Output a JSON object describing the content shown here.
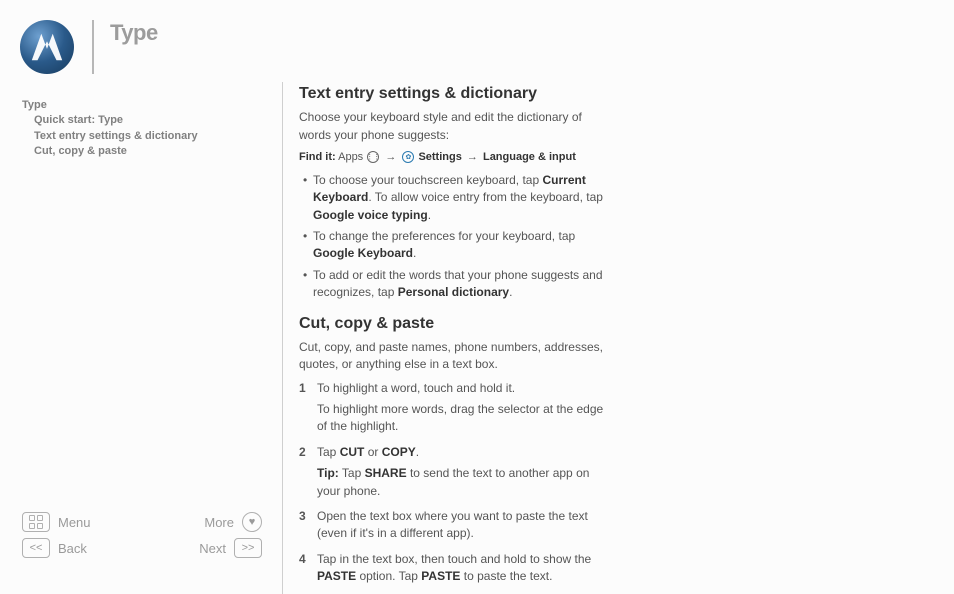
{
  "header": {
    "title": "Type"
  },
  "toc": {
    "root": "Type",
    "items": [
      "Quick start: Type",
      "Text entry settings & dictionary",
      "Cut, copy & paste"
    ]
  },
  "nav": {
    "menu": "Menu",
    "more": "More",
    "back": "Back",
    "next": "Next"
  },
  "section1": {
    "heading": "Text entry settings & dictionary",
    "intro": "Choose your keyboard style and edit the dictionary of words your phone suggests:",
    "findit_label": "Find it:",
    "findit_apps": "Apps",
    "findit_settings": "Settings",
    "findit_path": "Language & input",
    "b1_pre": "To choose your touchscreen keyboard, tap ",
    "b1_bold1": "Current Keyboard",
    "b1_mid": ". To allow voice entry from the keyboard, tap ",
    "b1_bold2": "Google voice typing",
    "b1_post": ".",
    "b2_pre": "To change the preferences for your keyboard, tap ",
    "b2_bold": "Google Keyboard",
    "b2_post": ".",
    "b3_pre": "To add or edit the words that your phone suggests and recognizes, tap ",
    "b3_bold": "Personal dictionary",
    "b3_post": "."
  },
  "section2": {
    "heading": "Cut, copy & paste",
    "intro": "Cut, copy, and paste names, phone numbers, addresses, quotes, or anything else in a text box.",
    "s1": "To highlight a word, touch and hold it.",
    "s1b": "To highlight more words, drag the selector at the edge of the highlight.",
    "s2_pre": "Tap  ",
    "s2_cut": "CUT",
    "s2_or": " or ",
    "s2_copy": "COPY",
    "s2_post": ".",
    "tip_label": "Tip:",
    "tip_pre": " Tap ",
    "tip_bold": "SHARE",
    "tip_post": " to send the text to another app on your phone.",
    "s3": "Open the text box where you want to paste the text (even if it's in a different app).",
    "s4_pre": "Tap in the text box, then touch and hold to show the ",
    "s4_bold1": "PASTE",
    "s4_mid": " option. Tap ",
    "s4_bold2": "PASTE",
    "s4_post": " to paste the text."
  }
}
